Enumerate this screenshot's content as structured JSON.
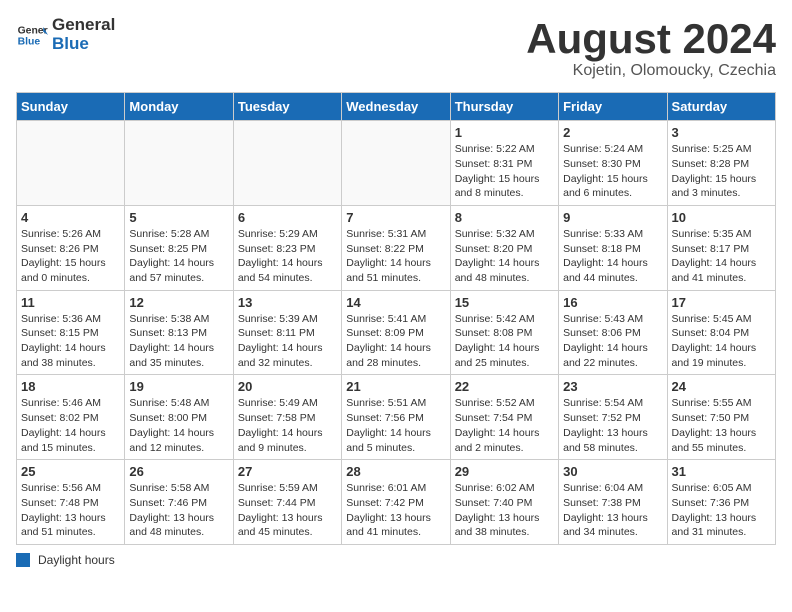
{
  "header": {
    "logo_general": "General",
    "logo_blue": "Blue",
    "month_year": "August 2024",
    "location": "Kojetin, Olomoucky, Czechia"
  },
  "legend": {
    "label": "Daylight hours"
  },
  "days_of_week": [
    "Sunday",
    "Monday",
    "Tuesday",
    "Wednesday",
    "Thursday",
    "Friday",
    "Saturday"
  ],
  "weeks": [
    [
      {
        "day": "",
        "info": ""
      },
      {
        "day": "",
        "info": ""
      },
      {
        "day": "",
        "info": ""
      },
      {
        "day": "",
        "info": ""
      },
      {
        "day": "1",
        "info": "Sunrise: 5:22 AM\nSunset: 8:31 PM\nDaylight: 15 hours and 8 minutes."
      },
      {
        "day": "2",
        "info": "Sunrise: 5:24 AM\nSunset: 8:30 PM\nDaylight: 15 hours and 6 minutes."
      },
      {
        "day": "3",
        "info": "Sunrise: 5:25 AM\nSunset: 8:28 PM\nDaylight: 15 hours and 3 minutes."
      }
    ],
    [
      {
        "day": "4",
        "info": "Sunrise: 5:26 AM\nSunset: 8:26 PM\nDaylight: 15 hours and 0 minutes."
      },
      {
        "day": "5",
        "info": "Sunrise: 5:28 AM\nSunset: 8:25 PM\nDaylight: 14 hours and 57 minutes."
      },
      {
        "day": "6",
        "info": "Sunrise: 5:29 AM\nSunset: 8:23 PM\nDaylight: 14 hours and 54 minutes."
      },
      {
        "day": "7",
        "info": "Sunrise: 5:31 AM\nSunset: 8:22 PM\nDaylight: 14 hours and 51 minutes."
      },
      {
        "day": "8",
        "info": "Sunrise: 5:32 AM\nSunset: 8:20 PM\nDaylight: 14 hours and 48 minutes."
      },
      {
        "day": "9",
        "info": "Sunrise: 5:33 AM\nSunset: 8:18 PM\nDaylight: 14 hours and 44 minutes."
      },
      {
        "day": "10",
        "info": "Sunrise: 5:35 AM\nSunset: 8:17 PM\nDaylight: 14 hours and 41 minutes."
      }
    ],
    [
      {
        "day": "11",
        "info": "Sunrise: 5:36 AM\nSunset: 8:15 PM\nDaylight: 14 hours and 38 minutes."
      },
      {
        "day": "12",
        "info": "Sunrise: 5:38 AM\nSunset: 8:13 PM\nDaylight: 14 hours and 35 minutes."
      },
      {
        "day": "13",
        "info": "Sunrise: 5:39 AM\nSunset: 8:11 PM\nDaylight: 14 hours and 32 minutes."
      },
      {
        "day": "14",
        "info": "Sunrise: 5:41 AM\nSunset: 8:09 PM\nDaylight: 14 hours and 28 minutes."
      },
      {
        "day": "15",
        "info": "Sunrise: 5:42 AM\nSunset: 8:08 PM\nDaylight: 14 hours and 25 minutes."
      },
      {
        "day": "16",
        "info": "Sunrise: 5:43 AM\nSunset: 8:06 PM\nDaylight: 14 hours and 22 minutes."
      },
      {
        "day": "17",
        "info": "Sunrise: 5:45 AM\nSunset: 8:04 PM\nDaylight: 14 hours and 19 minutes."
      }
    ],
    [
      {
        "day": "18",
        "info": "Sunrise: 5:46 AM\nSunset: 8:02 PM\nDaylight: 14 hours and 15 minutes."
      },
      {
        "day": "19",
        "info": "Sunrise: 5:48 AM\nSunset: 8:00 PM\nDaylight: 14 hours and 12 minutes."
      },
      {
        "day": "20",
        "info": "Sunrise: 5:49 AM\nSunset: 7:58 PM\nDaylight: 14 hours and 9 minutes."
      },
      {
        "day": "21",
        "info": "Sunrise: 5:51 AM\nSunset: 7:56 PM\nDaylight: 14 hours and 5 minutes."
      },
      {
        "day": "22",
        "info": "Sunrise: 5:52 AM\nSunset: 7:54 PM\nDaylight: 14 hours and 2 minutes."
      },
      {
        "day": "23",
        "info": "Sunrise: 5:54 AM\nSunset: 7:52 PM\nDaylight: 13 hours and 58 minutes."
      },
      {
        "day": "24",
        "info": "Sunrise: 5:55 AM\nSunset: 7:50 PM\nDaylight: 13 hours and 55 minutes."
      }
    ],
    [
      {
        "day": "25",
        "info": "Sunrise: 5:56 AM\nSunset: 7:48 PM\nDaylight: 13 hours and 51 minutes."
      },
      {
        "day": "26",
        "info": "Sunrise: 5:58 AM\nSunset: 7:46 PM\nDaylight: 13 hours and 48 minutes."
      },
      {
        "day": "27",
        "info": "Sunrise: 5:59 AM\nSunset: 7:44 PM\nDaylight: 13 hours and 45 minutes."
      },
      {
        "day": "28",
        "info": "Sunrise: 6:01 AM\nSunset: 7:42 PM\nDaylight: 13 hours and 41 minutes."
      },
      {
        "day": "29",
        "info": "Sunrise: 6:02 AM\nSunset: 7:40 PM\nDaylight: 13 hours and 38 minutes."
      },
      {
        "day": "30",
        "info": "Sunrise: 6:04 AM\nSunset: 7:38 PM\nDaylight: 13 hours and 34 minutes."
      },
      {
        "day": "31",
        "info": "Sunrise: 6:05 AM\nSunset: 7:36 PM\nDaylight: 13 hours and 31 minutes."
      }
    ]
  ]
}
